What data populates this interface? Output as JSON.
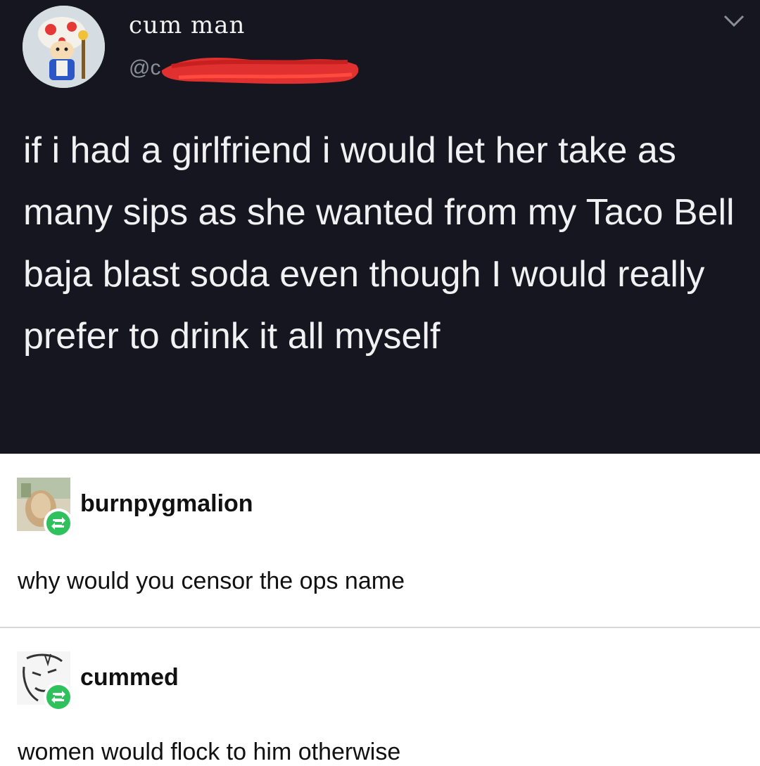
{
  "tweet": {
    "display_name": "cum man",
    "handle": "@c",
    "text": "if i had a girlfriend i would let her take as many sips as she wanted from my Taco Bell baja blast soda even though I would really prefer to drink it all myself",
    "avatar_icon": "toad-avatar-icon",
    "menu_icon": "chevron-down-icon",
    "background_color": "#15161f",
    "redaction_color": "#e0302f"
  },
  "comments": [
    {
      "username": "burnpygmalion",
      "text": "why would you censor the ops name",
      "badge_icon": "reblog-icon"
    },
    {
      "username": "cummed",
      "text": "women would flock to him otherwise",
      "badge_icon": "reblog-icon"
    }
  ],
  "colors": {
    "reblog_badge": "#2fc15d",
    "comment_text": "#111111"
  }
}
